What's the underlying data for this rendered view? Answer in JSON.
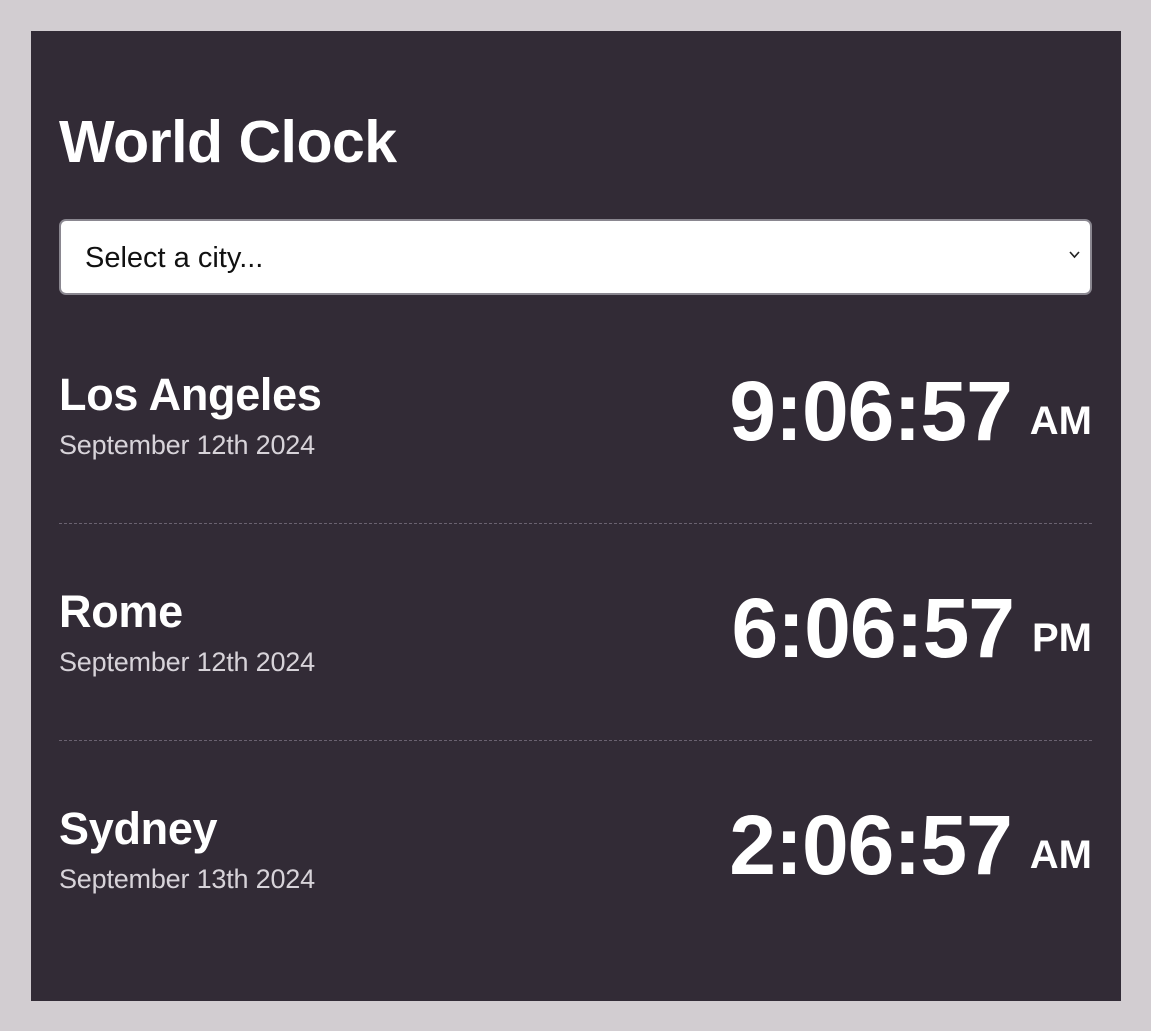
{
  "app": {
    "title": "World Clock"
  },
  "city_select": {
    "selected_label": "Select a city..."
  },
  "cities": [
    {
      "name": "Los Angeles",
      "date": "September 12th 2024",
      "time": "9:06:57",
      "period": "AM"
    },
    {
      "name": "Rome",
      "date": "September 12th 2024",
      "time": "6:06:57",
      "period": "PM"
    },
    {
      "name": "Sydney",
      "date": "September 13th 2024",
      "time": "2:06:57",
      "period": "AM"
    }
  ],
  "colors": {
    "page_background": "#d2cdd1",
    "panel_background": "#322b36",
    "text_primary": "#ffffff",
    "text_secondary": "#d7d3d9",
    "select_background": "#ffffff"
  },
  "icons": {
    "select_chevron": "chevron-down-icon"
  }
}
